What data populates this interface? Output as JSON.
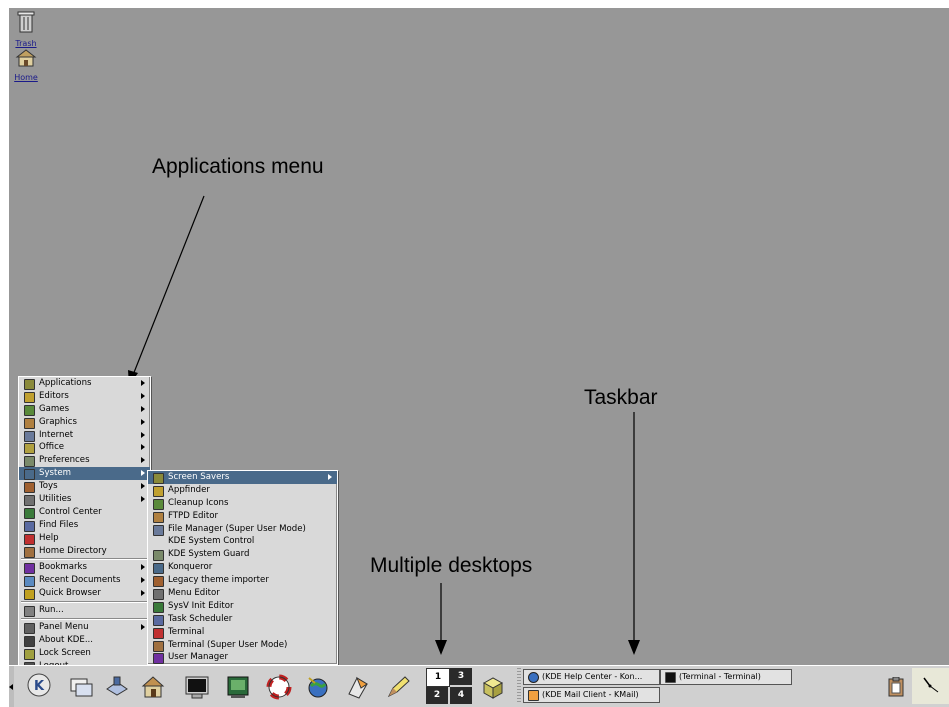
{
  "desktop": {
    "icons": [
      {
        "label": "Trash",
        "icon": "trash-icon"
      },
      {
        "label": "Home",
        "icon": "home-folder-icon"
      }
    ]
  },
  "annotations": {
    "applications_menu": "Applications menu",
    "taskbar": "Taskbar",
    "multiple_desktops": "Multiple desktops"
  },
  "main_menu": {
    "items": [
      {
        "label": "Applications",
        "icon": "applications-icon",
        "submenu": true
      },
      {
        "label": "Editors",
        "icon": "editors-icon",
        "submenu": true
      },
      {
        "label": "Games",
        "icon": "games-icon",
        "submenu": true
      },
      {
        "label": "Graphics",
        "icon": "graphics-icon",
        "submenu": true
      },
      {
        "label": "Internet",
        "icon": "internet-icon",
        "submenu": true
      },
      {
        "label": "Office",
        "icon": "office-icon",
        "submenu": true
      },
      {
        "label": "Preferences",
        "icon": "preferences-icon",
        "submenu": true
      },
      {
        "label": "System",
        "icon": "system-icon",
        "submenu": true,
        "selected": true
      },
      {
        "label": "Toys",
        "icon": "toys-icon",
        "submenu": true
      },
      {
        "label": "Utilities",
        "icon": "utilities-icon",
        "submenu": true
      },
      {
        "label": "Control Center",
        "icon": "control-center-icon"
      },
      {
        "label": "Find Files",
        "icon": "find-files-icon"
      },
      {
        "label": "Help",
        "icon": "help-icon"
      },
      {
        "label": "Home Directory",
        "icon": "home-directory-icon"
      },
      {
        "label": "Bookmarks",
        "icon": "bookmarks-icon",
        "submenu": true
      },
      {
        "label": "Recent Documents",
        "icon": "recent-documents-icon",
        "submenu": true
      },
      {
        "label": "Quick Browser",
        "icon": "quick-browser-icon",
        "submenu": true
      },
      {
        "label": "Run...",
        "icon": "run-icon"
      },
      {
        "label": "Panel Menu",
        "icon": "panel-menu-icon",
        "submenu": true
      },
      {
        "label": "About KDE...",
        "icon": "about-kde-icon"
      },
      {
        "label": "Lock Screen",
        "icon": "lock-screen-icon"
      },
      {
        "label": "Logout...",
        "icon": "logout-icon"
      }
    ]
  },
  "system_submenu": {
    "items": [
      {
        "label": "Screen Savers",
        "icon": "screen-savers-icon",
        "submenu": true,
        "selected": true
      },
      {
        "label": "Appfinder",
        "icon": "appfinder-icon"
      },
      {
        "label": "Cleanup Icons",
        "icon": "cleanup-icons-icon"
      },
      {
        "label": "FTPD Editor",
        "icon": "ftpd-editor-icon"
      },
      {
        "label": "File Manager (Super User Mode)",
        "icon": "file-manager-icon"
      },
      {
        "label": "KDE System Control",
        "icon": ""
      },
      {
        "label": "KDE System Guard",
        "icon": "system-guard-icon"
      },
      {
        "label": "Konqueror",
        "icon": "konqueror-icon"
      },
      {
        "label": "Legacy theme importer",
        "icon": "theme-importer-icon"
      },
      {
        "label": "Menu Editor",
        "icon": "menu-editor-icon"
      },
      {
        "label": "SysV Init Editor",
        "icon": "sysv-init-editor-icon"
      },
      {
        "label": "Task Scheduler",
        "icon": "task-scheduler-icon"
      },
      {
        "label": "Terminal",
        "icon": "terminal-icon"
      },
      {
        "label": "Terminal (Super User Mode)",
        "icon": "terminal-su-icon"
      },
      {
        "label": "User Manager",
        "icon": "user-manager-icon"
      }
    ]
  },
  "panel": {
    "launchers": [
      "kde-k-menu-icon",
      "window-list-icon",
      "desktop-access-icon",
      "home-icon",
      "terminal-icon",
      "control-center-icon",
      "help-lifebuoy-icon",
      "konqueror-globe-icon",
      "kmail-icon",
      "kwrite-pencil-icon"
    ],
    "pager": {
      "desktops": [
        "1",
        "3",
        "2",
        "4"
      ],
      "active": "1"
    },
    "desktop_button_icon": "show-desktop-box-icon",
    "tasks": [
      {
        "label": "(KDE Help Center - Kon...",
        "icon": "konqueror-globe-icon"
      },
      {
        "label": "(Terminal - Terminal)",
        "icon": "terminal-icon"
      },
      {
        "label": "(KDE Mail Client - KMail)",
        "icon": "kmail-icon"
      }
    ],
    "tray_icon": "klipper-clipboard-icon",
    "clock_icon": "analog-clock-icon"
  },
  "colors": {
    "desktop_bg": "#979797",
    "menu_bg": "#d9d9d9",
    "selection": "#4a6a8a",
    "panel_bg": "#d0d0d0"
  }
}
